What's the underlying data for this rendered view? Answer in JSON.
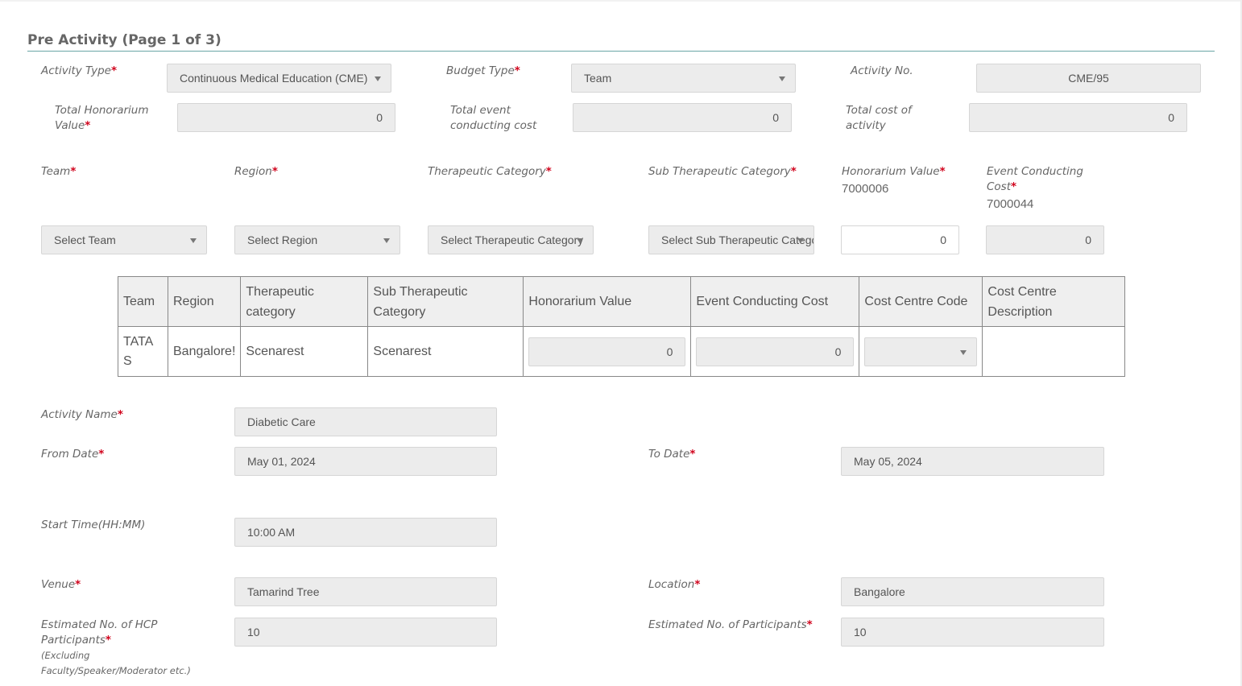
{
  "page": {
    "title": "Pre Activity (Page 1 of 3)"
  },
  "row1": {
    "activity_type": {
      "label": "Activity Type",
      "value": "Continuous Medical Education (CME)"
    },
    "budget_type": {
      "label": "Budget Type",
      "value": "Team"
    },
    "activity_no": {
      "label": "Activity No.",
      "value": "CME/95"
    }
  },
  "row2": {
    "total_honorarium": {
      "label_line1": "Total Honorarium",
      "label_line2": "Value",
      "value": "0"
    },
    "total_event_cost": {
      "label_line1": "Total event",
      "label_line2": "conducting cost",
      "value": "0"
    },
    "total_activity_cost": {
      "label_line1": "Total cost of",
      "label_line2": "activity",
      "value": "0"
    }
  },
  "row3": {
    "team": {
      "label": "Team",
      "placeholder": "Select Team"
    },
    "region": {
      "label": "Region",
      "placeholder": "Select Region"
    },
    "therapeutic": {
      "label": "Therapeutic Category",
      "placeholder": "Select Therapeutic Category"
    },
    "sub_therapeutic": {
      "label": "Sub Therapeutic Category",
      "placeholder": "Select Sub Therapeutic Category"
    },
    "honorarium": {
      "label": "Honorarium Value",
      "code": "7000006",
      "value": "0"
    },
    "event_cost": {
      "label_line1": "Event Conducting",
      "label_line2": "Cost",
      "code": "7000044",
      "value": "0"
    }
  },
  "table": {
    "headers": {
      "team": "Team",
      "region": "Region",
      "therapeutic_l1": "Therapeutic",
      "therapeutic_l2": "category",
      "sub_l1": "Sub Therapeutic",
      "sub_l2": "Category",
      "honorarium": "Honorarium Value",
      "event_cost": "Event Conducting Cost",
      "cost_centre_code": "Cost Centre Code",
      "ccd_l1": "Cost Centre",
      "ccd_l2": "Description"
    },
    "row": {
      "team_l1": "TATA",
      "team_l2": "S",
      "region": "Bangalore!",
      "therapeutic": "Scenarest",
      "sub_therapeutic": "Scenarest",
      "honorarium": "0",
      "event_cost": "0",
      "cost_centre_code": "",
      "cost_centre_description": ""
    }
  },
  "details": {
    "activity_name": {
      "label": "Activity Name",
      "value": "Diabetic Care"
    },
    "from_date": {
      "label": "From Date",
      "value": "May 01, 2024"
    },
    "to_date": {
      "label": "To Date",
      "value": "May 05, 2024"
    },
    "start_time": {
      "label": "Start Time(HH:MM)",
      "value": "10:00 AM"
    },
    "venue": {
      "label": "Venue",
      "value": "Tamarind Tree"
    },
    "location": {
      "label": "Location",
      "value": "Bangalore"
    },
    "hcp_participants": {
      "label_line1": "Estimated No. of HCP",
      "label_line2": "Participants",
      "note": "(Excluding Faculty/Speaker/Moderator etc.)",
      "value": "10"
    },
    "participants": {
      "label": "Estimated No. of Participants",
      "value": "10"
    }
  },
  "required_mark": "*"
}
